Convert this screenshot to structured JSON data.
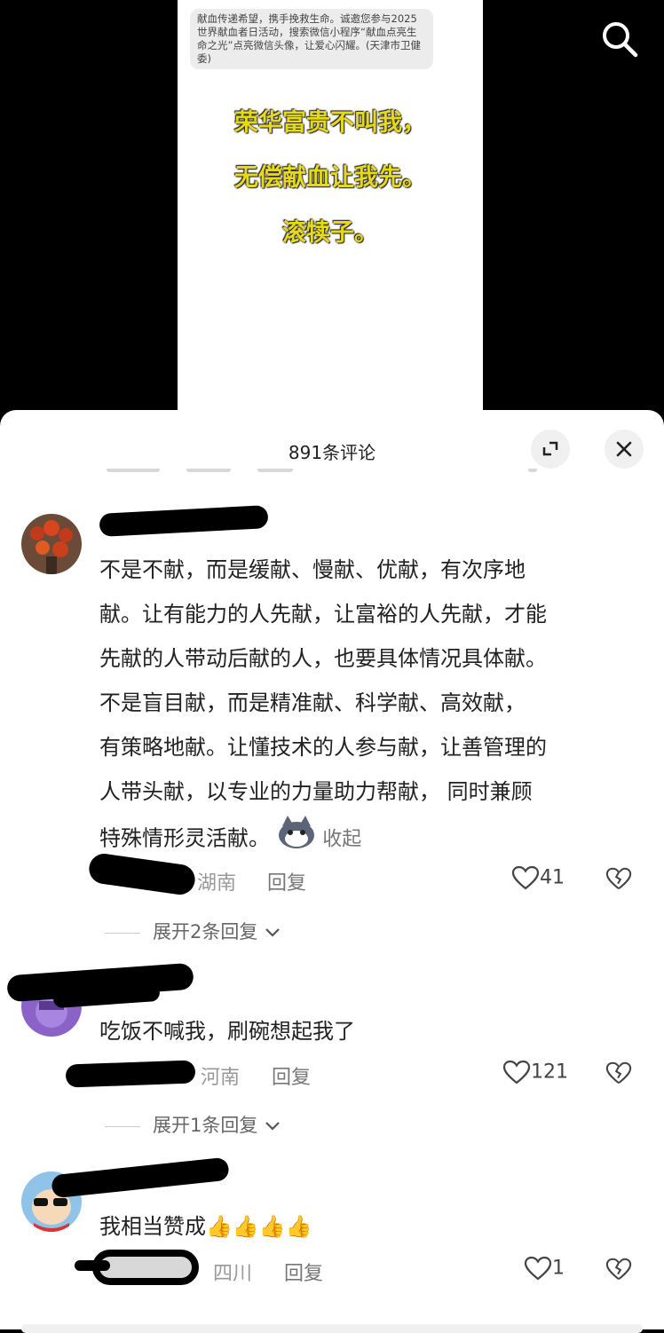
{
  "video": {
    "notice": "献血传递希望，携手挽救生命。诚邀您参与2025世界献血者日活动，搜索微信小程序“献血点亮生命之光”点亮微信头像，让爱心闪耀。(天津市卫健委)",
    "lines": [
      "荣华富贵不叫我，",
      "无偿献血让我先。",
      "滚犊子。"
    ]
  },
  "sheet": {
    "title": "891条评论"
  },
  "comments": [
    {
      "text_lines": [
        "不是不献，而是缓献、慢献、优献，有次序地",
        "献。让有能力的人先献，让富裕的人先献，才能",
        "先献的人带动后献的人，也要具体情况具体献。",
        "不是盲目献，而是精准献、科学献、高效献，",
        "有策略地献。让懂技术的人参与献，让善管理的",
        "人带头献，以专业的力量助力帮献， 同时兼顾"
      ],
      "last_line": "特殊情形灵活献。",
      "collapse": "收起",
      "region": "湖南",
      "reply": "回复",
      "likes": "41",
      "expand": "展开2条回复"
    },
    {
      "text": "吃饭不喊我，刷碗想起我了",
      "region": "河南",
      "reply": "回复",
      "likes": "121",
      "expand": "展开1条回复"
    },
    {
      "text": "我相当赞成",
      "emojis": "👍👍👍👍",
      "region": "四川",
      "reply": "回复",
      "likes": "1"
    }
  ],
  "colors": {
    "accent_yellow": "#e6d91c",
    "meta_gray": "#999999"
  }
}
